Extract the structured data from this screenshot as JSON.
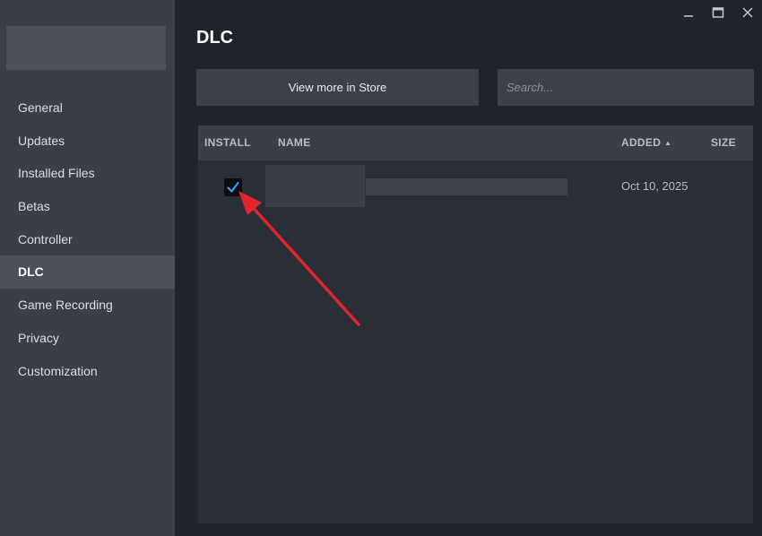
{
  "sidebar": {
    "items": [
      {
        "label": "General",
        "active": false
      },
      {
        "label": "Updates",
        "active": false
      },
      {
        "label": "Installed Files",
        "active": false
      },
      {
        "label": "Betas",
        "active": false
      },
      {
        "label": "Controller",
        "active": false
      },
      {
        "label": "DLC",
        "active": true
      },
      {
        "label": "Game Recording",
        "active": false
      },
      {
        "label": "Privacy",
        "active": false
      },
      {
        "label": "Customization",
        "active": false
      }
    ]
  },
  "window_controls": {
    "minimize_icon": "minimize-icon",
    "maximize_icon": "maximize-icon",
    "close_icon": "close-icon"
  },
  "main": {
    "title": "DLC",
    "store_button_label": "View more in Store",
    "search_placeholder": "Search...",
    "table": {
      "columns": {
        "install": "INSTALL",
        "name": "NAME",
        "added": "ADDED",
        "size": "SIZE"
      },
      "sort_column": "added",
      "sort_direction": "ascending",
      "rows": [
        {
          "installed": true,
          "added": "Oct 10, 2025"
        }
      ]
    }
  },
  "annotation": {
    "color": "#e0262b",
    "icon": "arrow-annotation-icon"
  },
  "colors": {
    "checkmark": "#3d9cf5",
    "active_nav": "#4b5059"
  }
}
